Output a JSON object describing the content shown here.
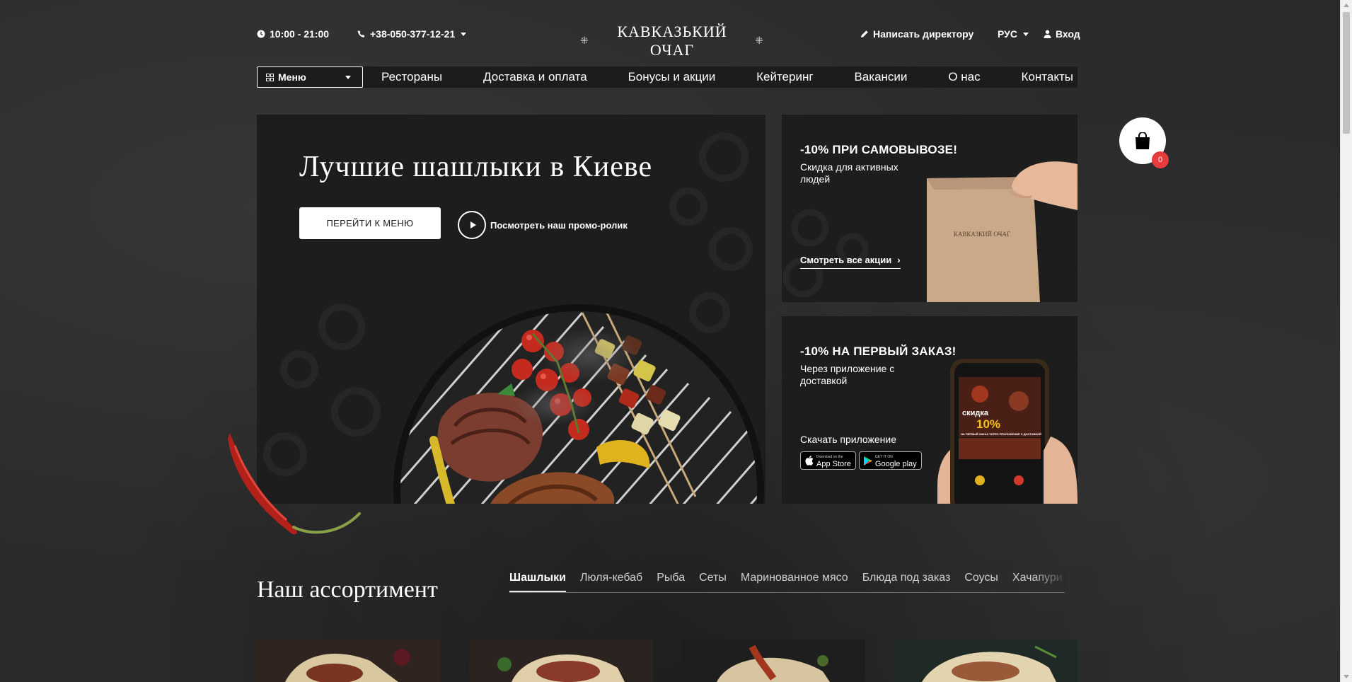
{
  "header": {
    "hours": "10:00 - 21:00",
    "phone": "+38-050-377-12-21",
    "logo_text": "КАВКАЗЬКИЙ ОЧАГ",
    "write_director": "Написать директору",
    "language": "РУС",
    "login": "Вход"
  },
  "nav": {
    "menu_label": "Меню",
    "links": [
      "Рестораны",
      "Доставка и оплата",
      "Бонусы и акции",
      "Кейтеринг",
      "Вакансии",
      "О нас",
      "Контакты"
    ]
  },
  "hero": {
    "title": "Лучшие шашлыки в Киеве",
    "cta": "ПЕРЕЙТИ К МЕНЮ",
    "promo": "Посмотреть наш промо-ролик"
  },
  "card1": {
    "title": "-10% ПРИ САМОВЫВОЗЕ!",
    "subtitle": "Скидка для активных людей",
    "link": "Смотреть все акции",
    "bag_text": "КАВКАЗКИЙ ОЧАГ"
  },
  "card2": {
    "title": "-10% НА ПЕРВЫЙ ЗАКАЗ!",
    "subtitle": "Через приложение с доставкой",
    "download": "Скачать приложение",
    "appstore_small": "Download on the",
    "appstore": "App Store",
    "gplay_small": "GET IT ON",
    "gplay": "Google play",
    "phone_promo_1": "скидка",
    "phone_promo_2": "10%",
    "phone_promo_3": "НА ПЕРВЫЙ ЗАКАЗ ЧЕРЕЗ ПРИЛОЖЕНИЕ С ДОСТАВКОЙ"
  },
  "cart": {
    "count": "0"
  },
  "assortment": {
    "title": "Наш ассортимент",
    "tabs": [
      "Шашлыки",
      "Люля-кебаб",
      "Рыба",
      "Сеты",
      "Маринованное мясо",
      "Блюда под заказ",
      "Соусы",
      "Хачапури"
    ],
    "active_tab": "Шашлыки"
  },
  "colors": {
    "background": "#2b2b2b",
    "panel": "#1d1d1d",
    "nav": "#1c1c1c",
    "badge": "#e83b3b"
  },
  "icons": [
    "clock-icon",
    "phone-icon",
    "pencil-icon",
    "user-icon",
    "grid-icon",
    "play-icon",
    "chevron-right-icon",
    "apple-icon",
    "google-play-icon",
    "shopping-bag-icon"
  ]
}
